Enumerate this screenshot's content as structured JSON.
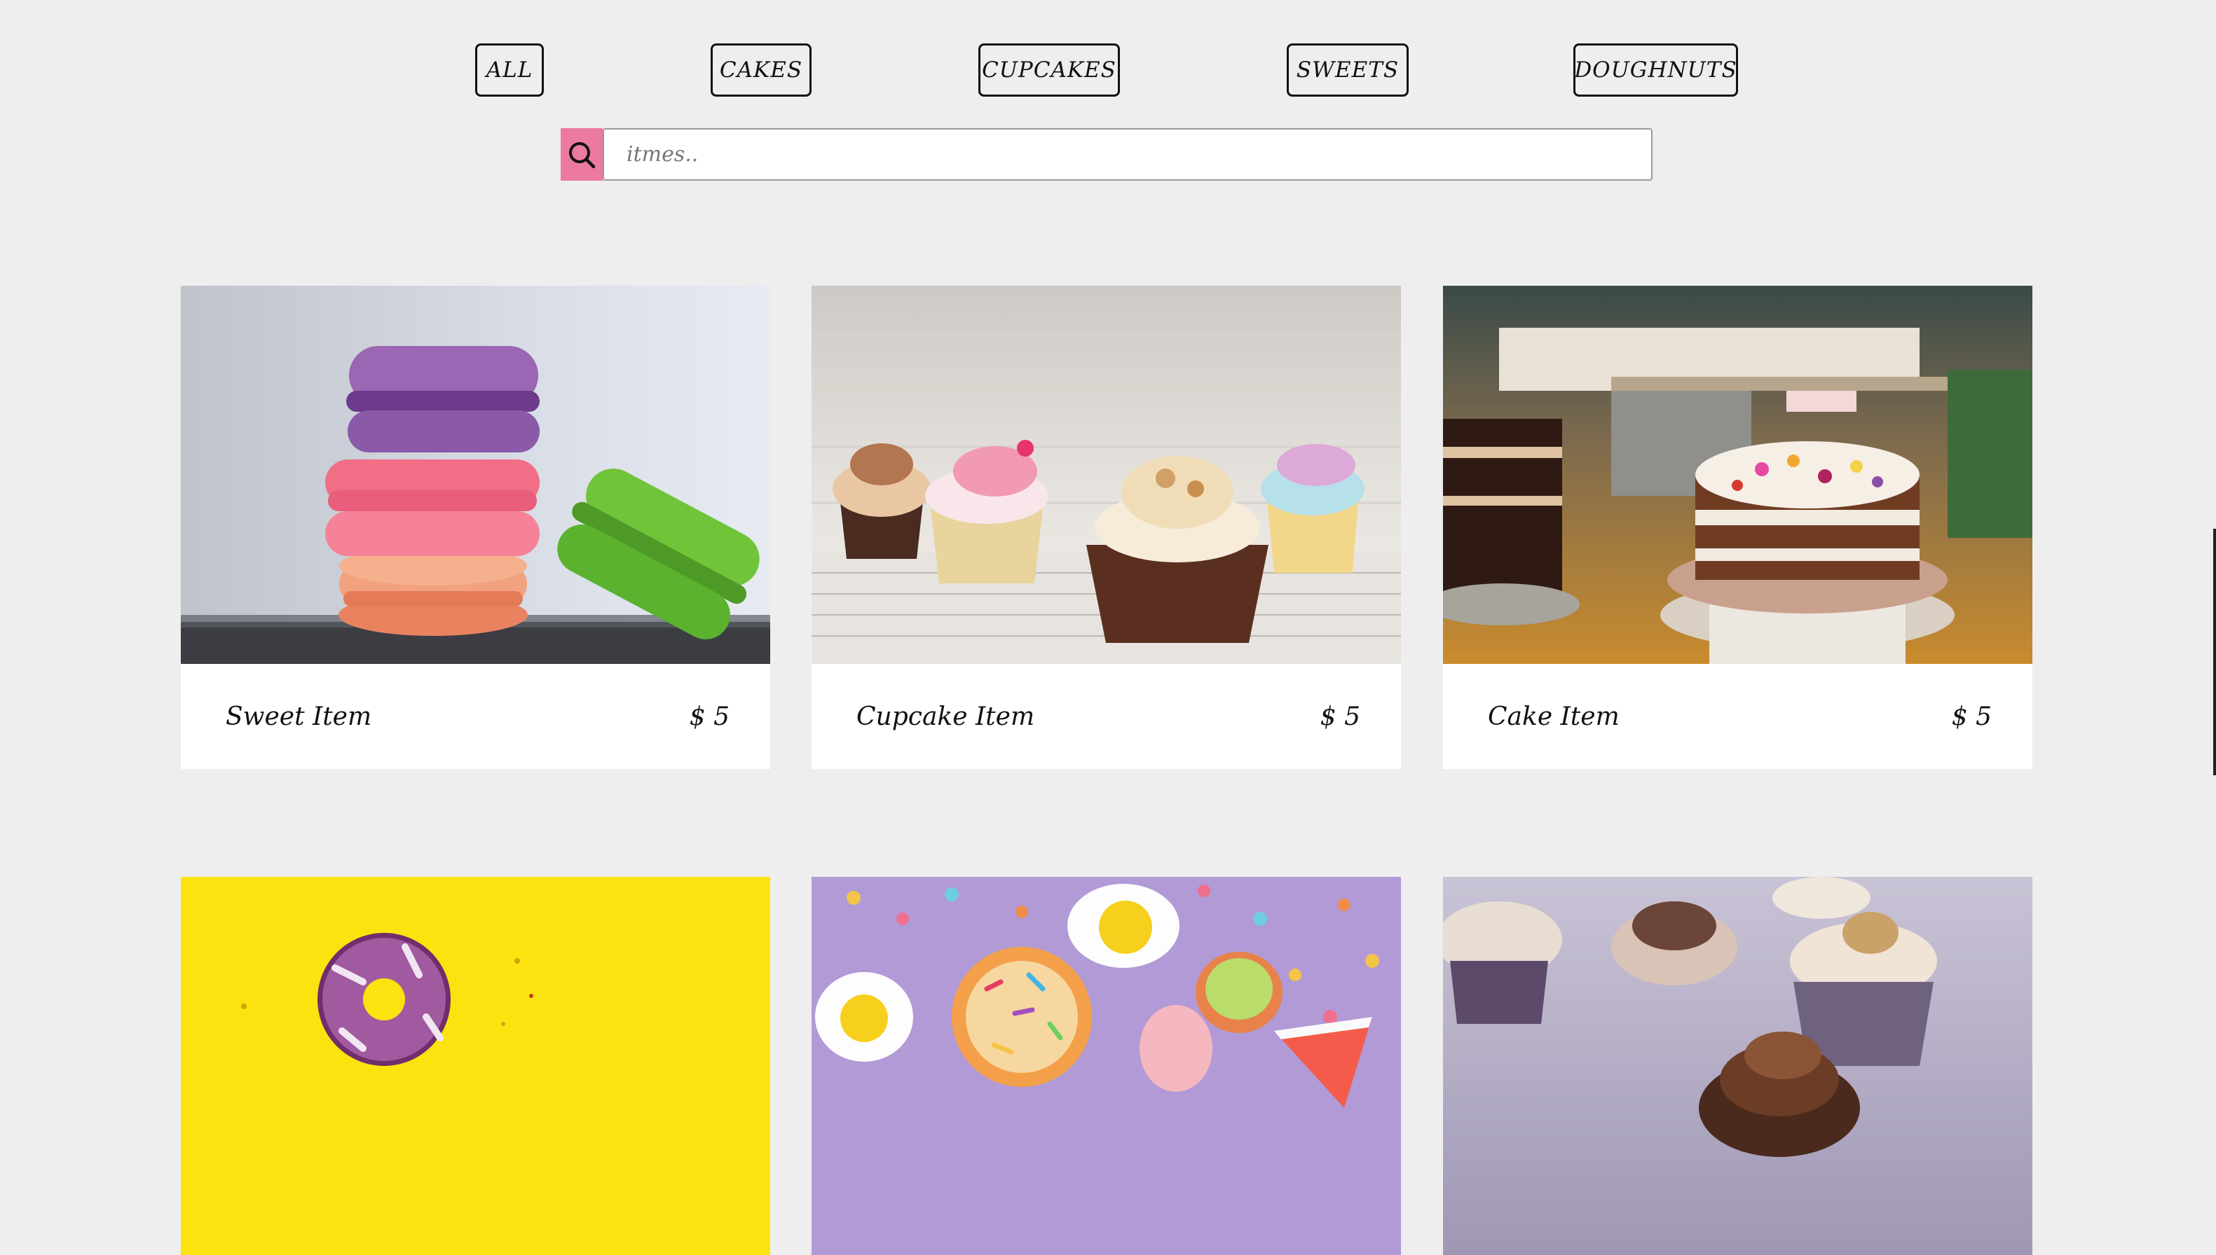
{
  "filters": {
    "all": "ALL",
    "cakes": "CAKES",
    "cupcakes": "CUPCAKES",
    "sweets": "SWEETS",
    "doughnuts": "DOUGHNUTS"
  },
  "search": {
    "placeholder": "itmes..",
    "icon": "search-icon",
    "icon_bg": "#ec7a9e"
  },
  "items": [
    {
      "title": "Sweet Item",
      "price": "$ 5",
      "image": "macarons"
    },
    {
      "title": "Cupcake Item",
      "price": "$ 5",
      "image": "cupcakes"
    },
    {
      "title": "Cake Item",
      "price": "$ 5",
      "image": "cake"
    },
    {
      "image": "doughnut"
    },
    {
      "image": "candy"
    },
    {
      "image": "chocolate-cupcakes"
    }
  ],
  "colors": {
    "background": "#eeeeee",
    "card": "#ffffff",
    "accent": "#ec7a9e"
  }
}
